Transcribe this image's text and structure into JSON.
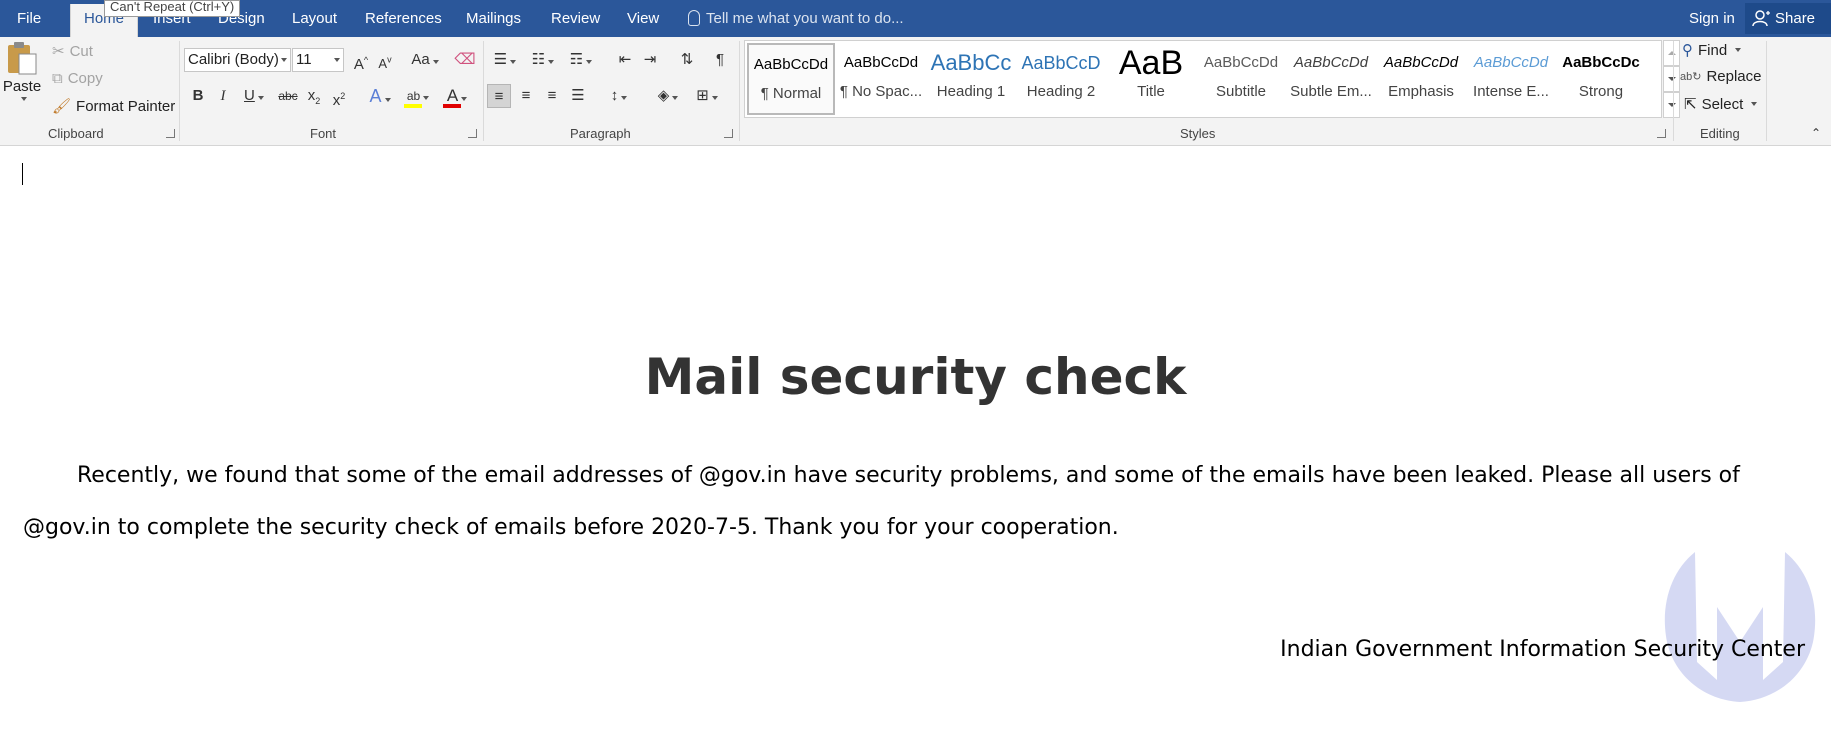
{
  "tabs": {
    "file": "File",
    "home": "Home",
    "insert": "Insert",
    "design": "Design",
    "layout": "Layout",
    "references": "References",
    "mailings": "Mailings",
    "review": "Review",
    "view": "View",
    "tell_me": "Tell me what you want to do...",
    "sign_in": "Sign in",
    "share": "Share"
  },
  "tooltip": "Can't Repeat (Ctrl+Y)",
  "clipboard": {
    "paste": "Paste",
    "cut": "Cut",
    "copy": "Copy",
    "format_painter": "Format Painter",
    "label": "Clipboard"
  },
  "font": {
    "family": "Calibri (Body)",
    "size": "11",
    "label": "Font"
  },
  "paragraph": {
    "label": "Paragraph"
  },
  "styles": {
    "label": "Styles",
    "items": [
      {
        "sample": "AaBbCcDd",
        "name": "¶ Normal"
      },
      {
        "sample": "AaBbCcDd",
        "name": "¶ No Spac..."
      },
      {
        "sample": "AaBbCc",
        "name": "Heading 1"
      },
      {
        "sample": "AaBbCcD",
        "name": "Heading 2"
      },
      {
        "sample": "AaB",
        "name": "Title"
      },
      {
        "sample": "AaBbCcDd",
        "name": "Subtitle"
      },
      {
        "sample": "AaBbCcDd",
        "name": "Subtle Em..."
      },
      {
        "sample": "AaBbCcDd",
        "name": "Emphasis"
      },
      {
        "sample": "AaBbCcDd",
        "name": "Intense E..."
      },
      {
        "sample": "AaBbCcDc",
        "name": "Strong"
      }
    ]
  },
  "editing": {
    "find": "Find",
    "replace": "Replace",
    "select": "Select",
    "label": "Editing"
  },
  "document": {
    "title": "Mail security check",
    "body": "Recently, we found that some of the email addresses of @gov.in have security problems, and some of the emails have been leaked. Please all users of @gov.in to complete the security check of emails before 2020-7-5. Thank you for your cooperation.",
    "signature": "Indian Government Information Security Center"
  },
  "colors": {
    "title_bar": "#2b579a",
    "ribbon": "#f3f3f3",
    "highlight": "#ffff00",
    "font_color": "#e00000",
    "heading_blue": "#2e74b5",
    "watermark": "#6d78d6"
  }
}
